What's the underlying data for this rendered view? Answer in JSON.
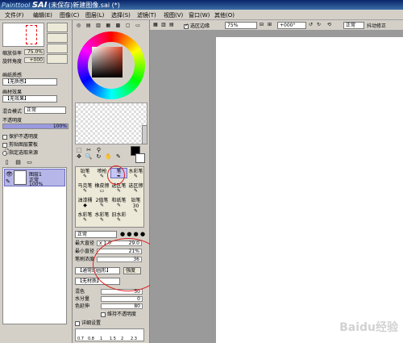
{
  "app": {
    "logo_prefix": "Paint",
    "logo_tool": "tool",
    "logo_name": "SAI",
    "title": "(未保存)新建图像.sai (*)"
  },
  "menu": [
    "文件(F)",
    "编辑(E)",
    "图像(C)",
    "图层(L)",
    "选择(S)",
    "滤镜(T)",
    "视图(V)",
    "窗口(W)",
    "其他(O)"
  ],
  "navigator": {
    "zoom_label": "缩放倍率",
    "zoom_value": "75.0%",
    "rotate_label": "旋转角度",
    "rotate_value": "+000"
  },
  "paper": {
    "texture_label": "画纸质感",
    "texture_value": "【无质感】",
    "effect_label": "画材效果",
    "effect_value": "【无效果】"
  },
  "layer_props": {
    "blend_label": "混合模式",
    "blend_value": "正常",
    "opacity_label": "不透明度",
    "opacity_value": "100%",
    "opt1": "保护不透明度",
    "opt2": "剪贴图层蒙板",
    "opt3": "指定选取来源"
  },
  "layer": {
    "name": "图层1",
    "mode": "正常",
    "opacity": "100%"
  },
  "toolbar": {
    "select_edge_label": "选区边缘",
    "zoom_value": "75%",
    "angle_value": "+000°",
    "blend_value": "正常",
    "stabilizer_label": "抖动修正"
  },
  "tools": [
    {
      "label": "铅笔",
      "glyph": "✎"
    },
    {
      "label": "喷枪",
      "glyph": "✎"
    },
    {
      "label": "笔",
      "glyph": "✒"
    },
    {
      "label": "水彩笔",
      "glyph": "✎"
    },
    {
      "label": "马克笔",
      "glyph": "✎"
    },
    {
      "label": "橡皮擦",
      "glyph": "▭"
    },
    {
      "label": "选区笔",
      "glyph": "✎"
    },
    {
      "label": "选区擦",
      "glyph": "✎"
    },
    {
      "label": "油漆桶",
      "glyph": "◆"
    },
    {
      "label": "2值笔",
      "glyph": "✎"
    },
    {
      "label": "和纸笔",
      "glyph": "✎"
    },
    {
      "label": "铅笔30",
      "glyph": "✎"
    },
    {
      "label": "水彩笔",
      "glyph": "✎"
    },
    {
      "label": "水彩笔",
      "glyph": "✎"
    },
    {
      "label": "旧水彩",
      "glyph": "✎"
    },
    {
      "label": "",
      "glyph": ""
    }
  ],
  "brush": {
    "mode": "正常",
    "max_size_label": "最大直径",
    "max_size_scale": "x 1.0",
    "max_size_value": "29.0",
    "max_size_fill": 0.29,
    "min_size_label": "最小直径",
    "min_size_value": "21%",
    "min_size_fill": 0.21,
    "density_label": "笔刷浓度",
    "density_value": "36",
    "density_fill": 0.36,
    "shape_value": "【通常的圆形】",
    "shape_btn": "强度",
    "texture_value": "【无材质】",
    "mix_label": "混色",
    "mix_value": "50",
    "water_label": "水分量",
    "water_value": "0",
    "persist_label": "色延伸",
    "persist_value": "80",
    "keep_opacity_label": "维持不透明度",
    "detail_label": "详细设置",
    "presets": [
      "0.7",
      "0.8",
      "1",
      "1.5",
      "2",
      "2.3"
    ]
  },
  "watermark": "Baidu经验"
}
